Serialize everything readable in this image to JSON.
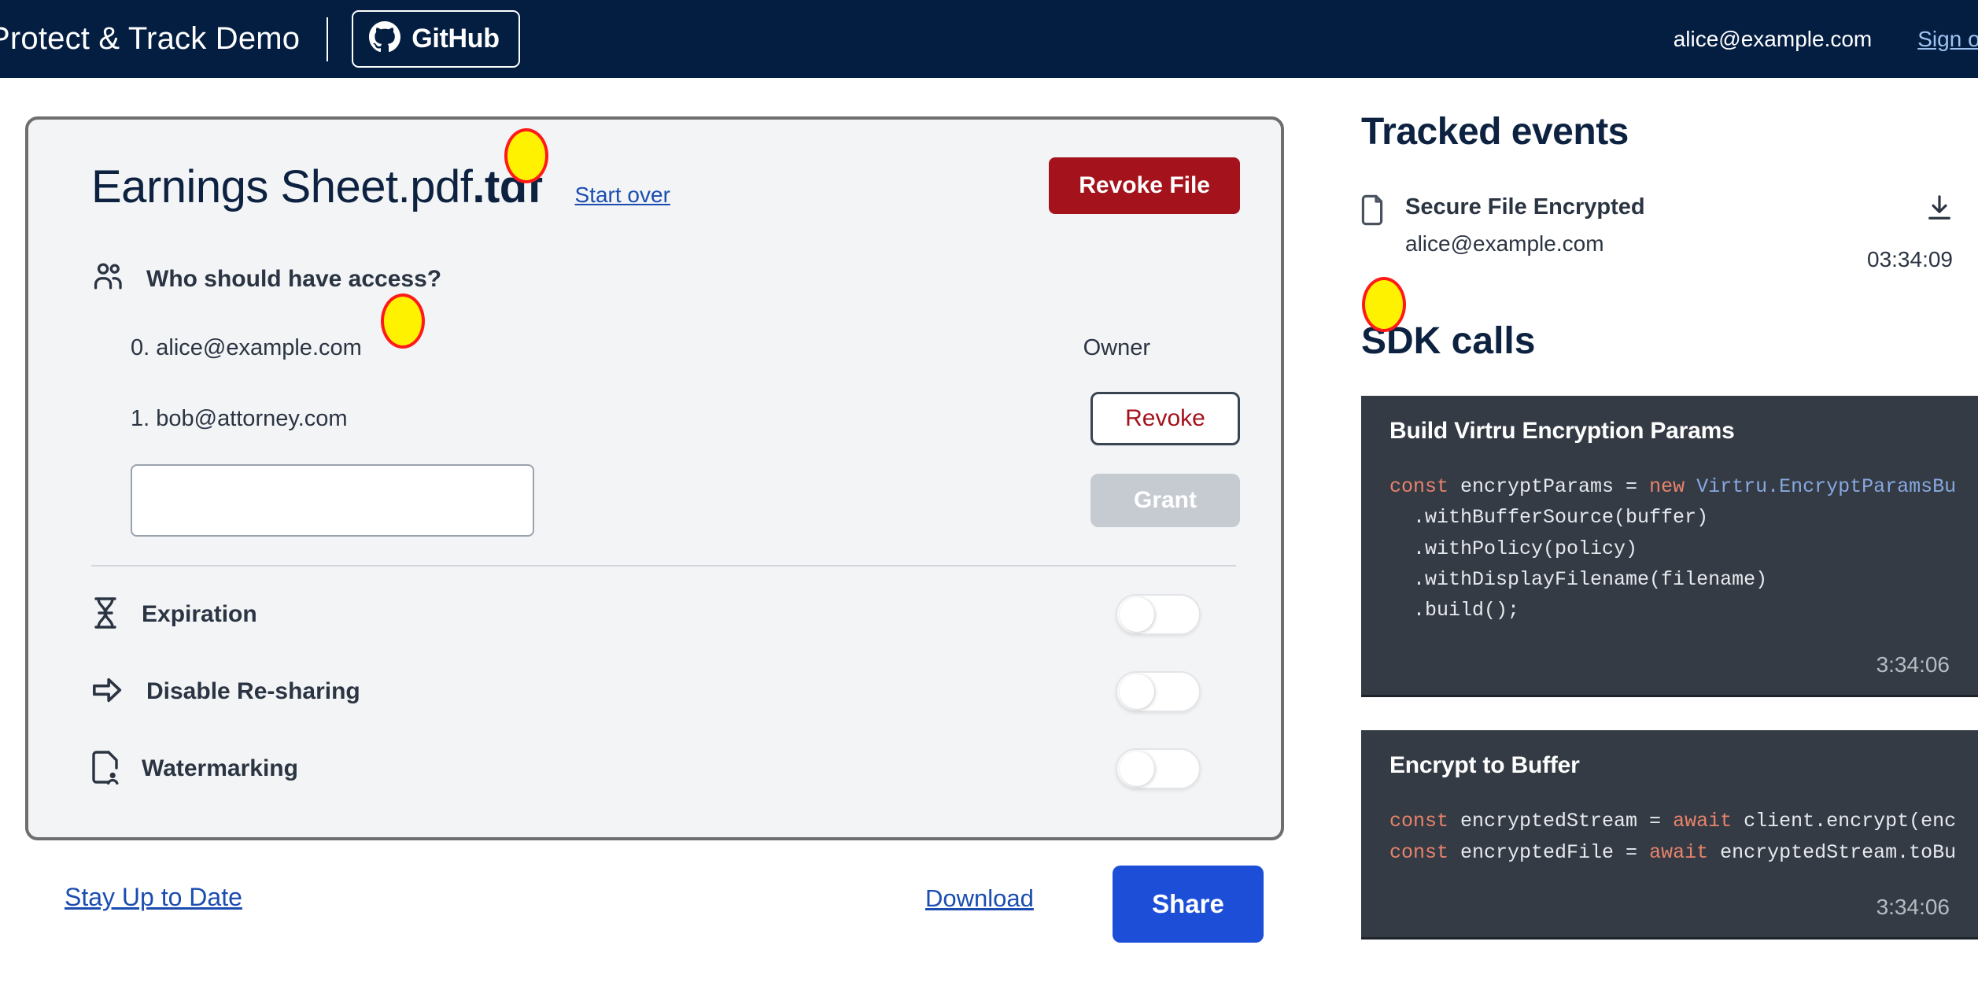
{
  "topbar": {
    "brand_title": "Protect & Track Demo",
    "github_label": "GitHub",
    "github_icon": "github-icon",
    "user_email": "alice@example.com",
    "sign_out": "Sign out"
  },
  "file_card": {
    "filename_base": "Earnings Sheet.pdf",
    "filename_ext": ".tdf",
    "start_over": "Start over",
    "revoke_file": "Revoke File",
    "access_heading": "Who should have access?",
    "access_icon": "users-icon",
    "rows": [
      {
        "label": "0. alice@example.com",
        "right_type": "text",
        "right_label": "Owner"
      },
      {
        "label": "1. bob@attorney.com",
        "right_type": "button",
        "right_label": "Revoke"
      }
    ],
    "new_email_value": "",
    "new_email_placeholder": "",
    "grant_label": "Grant",
    "options": [
      {
        "label": "Expiration",
        "icon": "hourglass-icon",
        "enabled": false
      },
      {
        "label": "Disable Re-sharing",
        "icon": "arrow-right-icon",
        "enabled": false
      },
      {
        "label": "Watermarking",
        "icon": "document-person-icon",
        "enabled": false
      }
    ]
  },
  "footer": {
    "stay_up_to_date": "Stay Up to Date",
    "download": "Download",
    "share": "Share"
  },
  "tracked_events": {
    "title": "Tracked events",
    "items": [
      {
        "icon": "file-icon",
        "name": "Secure File Encrypted",
        "actor": "alice@example.com",
        "action_icon": "download-icon",
        "time": "03:34:09"
      }
    ]
  },
  "sdk_calls": {
    "title": "SDK calls",
    "cards": [
      {
        "title": "Build Virtru Encryption Params",
        "time": "3:34:06",
        "lines": [
          [
            {
              "t": "const ",
              "c": "k-const"
            },
            {
              "t": "encryptParams = ",
              "c": ""
            },
            {
              "t": "new ",
              "c": "k-new"
            },
            {
              "t": "Virtru.EncryptParamsBu",
              "c": "k-cls"
            }
          ],
          [
            {
              "t": "  .withBufferSource(buffer)",
              "c": ""
            }
          ],
          [
            {
              "t": "  .withPolicy(policy)",
              "c": ""
            }
          ],
          [
            {
              "t": "  .withDisplayFilename(filename)",
              "c": ""
            }
          ],
          [
            {
              "t": "  .build();",
              "c": ""
            }
          ]
        ]
      },
      {
        "title": "Encrypt to Buffer",
        "time": "3:34:06",
        "lines": [
          [
            {
              "t": "const ",
              "c": "k-const"
            },
            {
              "t": "encryptedStream = ",
              "c": ""
            },
            {
              "t": "await ",
              "c": "k-await"
            },
            {
              "t": "client.encrypt(enc",
              "c": ""
            }
          ],
          [
            {
              "t": "const ",
              "c": "k-const"
            },
            {
              "t": "encryptedFile = ",
              "c": ""
            },
            {
              "t": "await ",
              "c": "k-await"
            },
            {
              "t": "encryptedStream.toBu",
              "c": ""
            }
          ]
        ]
      }
    ]
  },
  "colors": {
    "navy": "#041E42",
    "danger": "#A4121C",
    "link": "#1B4DB1",
    "share_blue": "#1D4ED8",
    "code_bg": "#343B45",
    "marker_fill": "#FFF200",
    "marker_stroke": "#FF1A1A"
  }
}
